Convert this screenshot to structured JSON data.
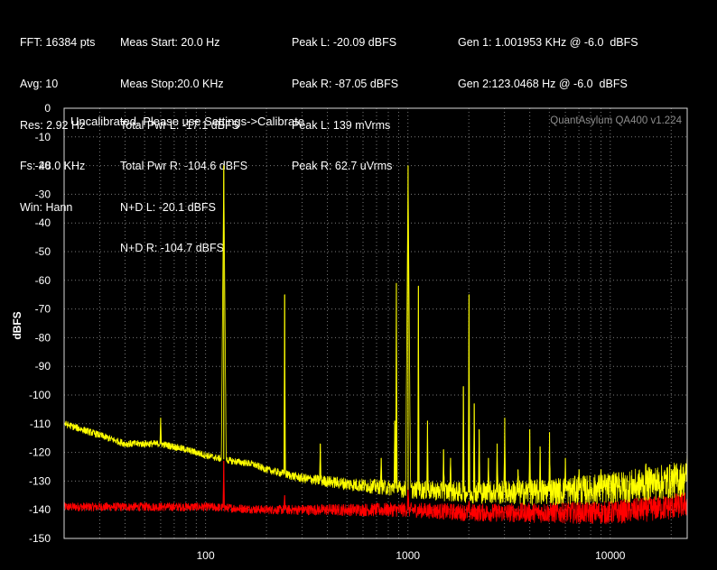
{
  "header": {
    "col1": [
      "FFT: 16384 pts",
      "Avg: 10",
      "Res: 2.92 Hz",
      "Fs: 48.0 KHz",
      "Win: Hann"
    ],
    "col2": [
      "Meas Start: 20.0 Hz",
      "Meas Stop:20.0 KHz",
      "Total Pwr L: -17.1 dBFS",
      "Total Pwr R: -104.6 dBFS",
      "N+D L: -20.1 dBFS",
      "N+D R: -104.7 dBFS"
    ],
    "col3": [
      "Peak L: -20.09 dBFS",
      "Peak R: -87.05 dBFS",
      "Peak L: 139 mVrms",
      "Peak R: 62.7 uVrms"
    ],
    "col4": [
      "Gen 1: 1.001953 KHz @ -6.0  dBFS",
      "Gen 2:123.0468 Hz @ -6.0  dBFS"
    ]
  },
  "plot": {
    "note": "Uncalibrated. Please use Settings->Calibrate",
    "brand": "QuantAsylum QA400 v1.224"
  },
  "chart_data": {
    "type": "line",
    "title": "",
    "xlabel": "",
    "ylabel": "dBFS",
    "xscale": "log",
    "xlim": [
      20,
      24000
    ],
    "ylim": [
      -150,
      0
    ],
    "yticks": [
      0,
      -10,
      -20,
      -30,
      -40,
      -50,
      -60,
      -70,
      -80,
      -90,
      -100,
      -110,
      -120,
      -130,
      -140,
      -150
    ],
    "xticks": [
      {
        "value": 100,
        "label": "100"
      },
      {
        "value": 1000,
        "label": "1000"
      },
      {
        "value": 10000,
        "label": "10000"
      }
    ],
    "grid": true,
    "series": [
      {
        "color": "#ffff00",
        "noise_floor": [
          [
            20,
            -110
          ],
          [
            30,
            -114
          ],
          [
            40,
            -117
          ],
          [
            60,
            -117
          ],
          [
            80,
            -119
          ],
          [
            100,
            -121
          ],
          [
            115,
            -122
          ],
          [
            135,
            -123
          ],
          [
            170,
            -124
          ],
          [
            200,
            -126
          ],
          [
            300,
            -129
          ],
          [
            500,
            -131
          ],
          [
            1000,
            -133
          ],
          [
            2000,
            -134
          ],
          [
            4000,
            -134
          ],
          [
            8000,
            -133
          ],
          [
            12000,
            -132
          ],
          [
            20000,
            -130
          ],
          [
            24000,
            -129
          ]
        ],
        "peaks": [
          [
            60,
            -108
          ],
          [
            123,
            -20
          ],
          [
            246,
            -65
          ],
          [
            369,
            -117
          ],
          [
            738,
            -122
          ],
          [
            861,
            -109
          ],
          [
            877,
            -61
          ],
          [
            1002,
            -20
          ],
          [
            1127,
            -62
          ],
          [
            1250,
            -109
          ],
          [
            1500,
            -119
          ],
          [
            1625,
            -122
          ],
          [
            1880,
            -97
          ],
          [
            2004,
            -65
          ],
          [
            2127,
            -103
          ],
          [
            2250,
            -112
          ],
          [
            2500,
            -122
          ],
          [
            2760,
            -117
          ],
          [
            3010,
            -108
          ],
          [
            3500,
            -126
          ],
          [
            4000,
            -112
          ],
          [
            4500,
            -118
          ],
          [
            5010,
            -113
          ],
          [
            6000,
            -122
          ],
          [
            7010,
            -126
          ],
          [
            9000,
            -126
          ],
          [
            11000,
            -127
          ],
          [
            15000,
            -124
          ],
          [
            16000,
            -126
          ],
          [
            24000,
            -121
          ]
        ]
      },
      {
        "color": "#ff0000",
        "noise_floor": [
          [
            20,
            -139
          ],
          [
            50,
            -139
          ],
          [
            100,
            -139
          ],
          [
            200,
            -140
          ],
          [
            500,
            -140
          ],
          [
            1000,
            -140
          ],
          [
            2000,
            -141
          ],
          [
            5000,
            -141
          ],
          [
            10000,
            -141
          ],
          [
            20000,
            -139
          ],
          [
            24000,
            -138
          ]
        ],
        "peaks": [
          [
            123,
            -123
          ],
          [
            246,
            -135
          ],
          [
            1002,
            -131
          ],
          [
            2004,
            -137
          ]
        ]
      }
    ]
  }
}
